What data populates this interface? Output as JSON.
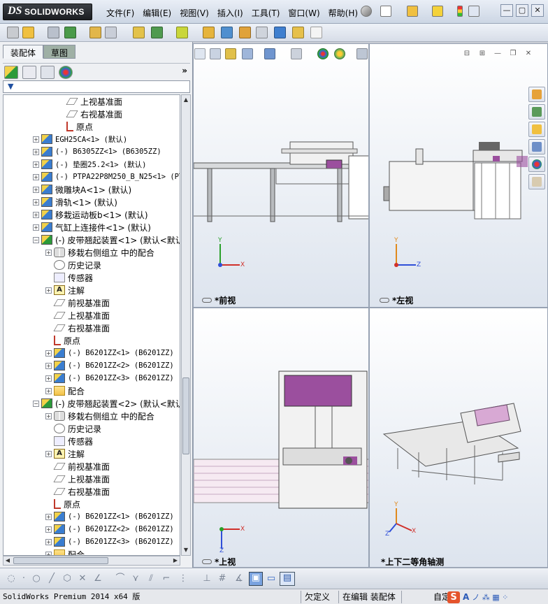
{
  "app": {
    "logo_mark": "DS",
    "logo_name": "SOLIDWORKS"
  },
  "menu": [
    "文件(F)",
    "编辑(E)",
    "视图(V)",
    "插入(I)",
    "工具(T)",
    "窗口(W)",
    "帮助(H)"
  ],
  "window_controls": {
    "minimize": "—",
    "restore": "▢",
    "close": "✕"
  },
  "left_panel": {
    "tabs": [
      "装配体",
      "草图"
    ],
    "active_tab": "装配体",
    "more": "»",
    "filter_icon": "▼"
  },
  "tree": [
    {
      "indent": 2,
      "expander": "",
      "icon": "plane",
      "label": "上视基准面",
      "mono": false
    },
    {
      "indent": 2,
      "expander": "",
      "icon": "plane",
      "label": "右视基准面",
      "mono": false
    },
    {
      "indent": 2,
      "expander": "",
      "icon": "origin",
      "label": "原点",
      "mono": false
    },
    {
      "indent": 0,
      "expander": "+",
      "icon": "part",
      "label": "EGH25CA<1> (默认)",
      "mono": true
    },
    {
      "indent": 0,
      "expander": "+",
      "icon": "part",
      "label": "(-) B6305ZZ<1> (B6305ZZ)",
      "mono": true
    },
    {
      "indent": 0,
      "expander": "+",
      "icon": "part",
      "label": "(-) 垫圈25.2<1> (默认)",
      "mono": true
    },
    {
      "indent": 0,
      "expander": "+",
      "icon": "part",
      "label": "(-) PTPA22P8M250_B_N25<1> (PTP",
      "mono": true
    },
    {
      "indent": 0,
      "expander": "+",
      "icon": "part",
      "label": "微雕块A<1> (默认)",
      "mono": false
    },
    {
      "indent": 0,
      "expander": "+",
      "icon": "part",
      "label": "滑轨<1> (默认)",
      "mono": false
    },
    {
      "indent": 0,
      "expander": "+",
      "icon": "part",
      "label": "移栽运动板b<1> (默认)",
      "mono": false
    },
    {
      "indent": 0,
      "expander": "+",
      "icon": "part",
      "label": "气缸上连接件<1> (默认)",
      "mono": false
    },
    {
      "indent": 0,
      "expander": "−",
      "icon": "asm",
      "label": "(-) 皮带翘起装置<1> (默认<默认",
      "mono": false
    },
    {
      "indent": 1,
      "expander": "+",
      "icon": "mate",
      "label": "移栽右侧组立 中的配合",
      "mono": false
    },
    {
      "indent": 1,
      "expander": "",
      "icon": "hist",
      "label": "历史记录",
      "mono": false
    },
    {
      "indent": 1,
      "expander": "",
      "icon": "sensor",
      "label": "传感器",
      "mono": false
    },
    {
      "indent": 1,
      "expander": "+",
      "icon": "note",
      "label": "注解",
      "mono": false
    },
    {
      "indent": 1,
      "expander": "",
      "icon": "plane",
      "label": "前视基准面",
      "mono": false
    },
    {
      "indent": 1,
      "expander": "",
      "icon": "plane",
      "label": "上视基准面",
      "mono": false
    },
    {
      "indent": 1,
      "expander": "",
      "icon": "plane",
      "label": "右视基准面",
      "mono": false
    },
    {
      "indent": 1,
      "expander": "",
      "icon": "origin",
      "label": "原点",
      "mono": false
    },
    {
      "indent": 1,
      "expander": "+",
      "icon": "part",
      "label": "(-) B6201ZZ<1> (B6201ZZ)",
      "mono": true
    },
    {
      "indent": 1,
      "expander": "+",
      "icon": "part",
      "label": "(-) B6201ZZ<2> (B6201ZZ)",
      "mono": true
    },
    {
      "indent": 1,
      "expander": "+",
      "icon": "part",
      "label": "(-) B6201ZZ<3> (B6201ZZ)",
      "mono": true
    },
    {
      "indent": 1,
      "expander": "+",
      "icon": "matefolder",
      "label": "配合",
      "mono": false
    },
    {
      "indent": 0,
      "expander": "−",
      "icon": "asm",
      "label": "(-) 皮带翘起装置<2> (默认<默认",
      "mono": false
    },
    {
      "indent": 1,
      "expander": "+",
      "icon": "mate",
      "label": "移栽右侧组立 中的配合",
      "mono": false
    },
    {
      "indent": 1,
      "expander": "",
      "icon": "hist",
      "label": "历史记录",
      "mono": false
    },
    {
      "indent": 1,
      "expander": "",
      "icon": "sensor",
      "label": "传感器",
      "mono": false
    },
    {
      "indent": 1,
      "expander": "+",
      "icon": "note",
      "label": "注解",
      "mono": false
    },
    {
      "indent": 1,
      "expander": "",
      "icon": "plane",
      "label": "前视基准面",
      "mono": false
    },
    {
      "indent": 1,
      "expander": "",
      "icon": "plane",
      "label": "上视基准面",
      "mono": false
    },
    {
      "indent": 1,
      "expander": "",
      "icon": "plane",
      "label": "右视基准面",
      "mono": false
    },
    {
      "indent": 1,
      "expander": "",
      "icon": "origin",
      "label": "原点",
      "mono": false
    },
    {
      "indent": 1,
      "expander": "+",
      "icon": "part",
      "label": "(-) B6201ZZ<1> (B6201ZZ)",
      "mono": true
    },
    {
      "indent": 1,
      "expander": "+",
      "icon": "part",
      "label": "(-) B6201ZZ<2> (B6201ZZ)",
      "mono": true
    },
    {
      "indent": 1,
      "expander": "+",
      "icon": "part",
      "label": "(-) B6201ZZ<3> (B6201ZZ)",
      "mono": true
    },
    {
      "indent": 1,
      "expander": "+",
      "icon": "matefolder",
      "label": "配合",
      "mono": false
    }
  ],
  "viewports": {
    "front": {
      "label": "*前视",
      "axes": [
        "Y",
        "X"
      ]
    },
    "left": {
      "label": "*左视",
      "axes": [
        "Y",
        "Z"
      ]
    },
    "top": {
      "label": "*上视",
      "axes": [
        "X",
        "Z"
      ]
    },
    "iso": {
      "label": "*上下二等角轴测",
      "axes": [
        "Y",
        "X",
        "Z"
      ]
    }
  },
  "statusbar": {
    "product": "SolidWorks Premium 2014 x64 版",
    "state": "欠定义",
    "editing": "在编辑 装配体",
    "custom": "自定"
  },
  "ime": {
    "logo": "S",
    "lang": "A",
    "extra": "ノ ⁂ ▦ ⁘"
  },
  "colors": {
    "accent_purple": "#9b4f9e",
    "frame_gray": "#6f7478",
    "axis_x": "#d0302a",
    "axis_y": "#2aa02a",
    "axis_z": "#2f4fd8",
    "axis_y_left": "#e08a1e"
  }
}
